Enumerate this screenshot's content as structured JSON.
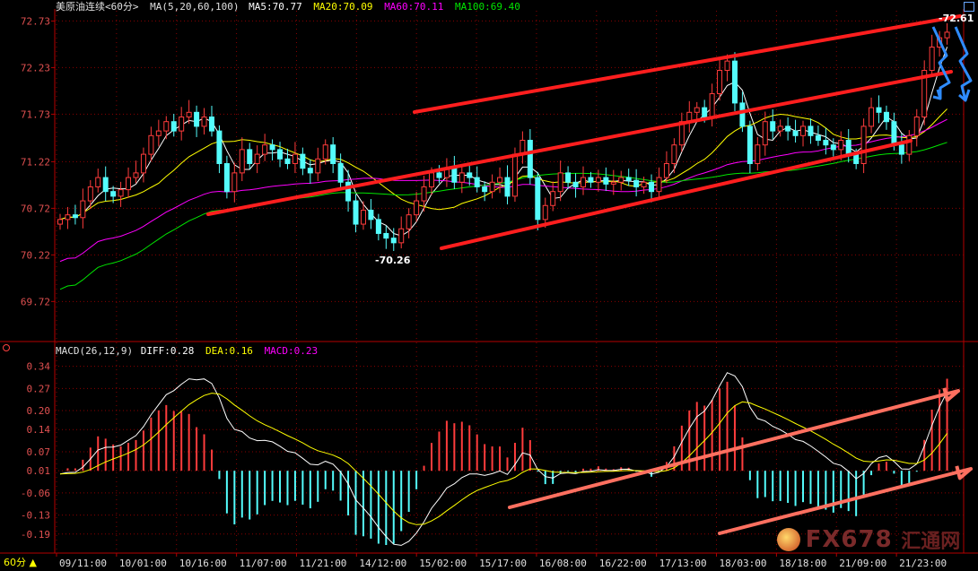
{
  "header": {
    "instrument": "美原油连续",
    "period": "<60分>",
    "ma_label": "MA(5,20,60,100)",
    "ma5": "MA5:70.77",
    "ma20": "MA20:70.09",
    "ma60": "MA60:70.11",
    "ma100": "MA100:69.40"
  },
  "macd_header": {
    "name": "MACD(26,12,9)",
    "diff": "DIFF:0.28",
    "dea": "DEA:0.16",
    "macd": "MACD:0.23"
  },
  "period_selector": "60分 ▲",
  "watermark": {
    "text": "FX678",
    "sub": "汇通网"
  },
  "colors": {
    "bg": "#000000",
    "up": "#ff3c3c",
    "down": "#54fcfc",
    "ma5": "#ffffff",
    "ma20": "#ffff00",
    "ma60": "#ff00ff",
    "ma100": "#00e600",
    "trend": "#ff1e1e",
    "arrow_up": "#ff7060",
    "blue_arrow": "#2f8cff",
    "grid": "#8a0000",
    "frame": "#b40000"
  },
  "chart_data": [
    {
      "type": "candlestick",
      "title": "美原油连续 <60分>",
      "y_ticks": [
        "72.73",
        "72.23",
        "71.73",
        "71.22",
        "70.72",
        "70.22",
        "69.72"
      ],
      "y_tick_values": [
        72.73,
        72.23,
        71.73,
        71.22,
        70.72,
        70.22,
        69.72
      ],
      "ylim": [
        69.3,
        72.84
      ],
      "x_ticks": [
        "09/11:00",
        "10/01:00",
        "10/16:00",
        "11/07:00",
        "11/21:00",
        "14/12:00",
        "15/02:00",
        "15/17:00",
        "16/08:00",
        "16/22:00",
        "17/13:00",
        "18/03:00",
        "18/18:00",
        "21/09:00",
        "21/23:00"
      ],
      "annotations": [
        {
          "label": "70.26",
          "value": 70.26
        },
        {
          "label": "72.61",
          "value": 72.61
        }
      ],
      "series": [
        {
          "name": "MA5",
          "value": 70.77
        },
        {
          "name": "MA20",
          "value": 70.09
        },
        {
          "name": "MA60",
          "value": 70.11
        },
        {
          "name": "MA100",
          "value": 69.4
        }
      ],
      "closes": [
        70.6,
        70.65,
        70.62,
        70.8,
        70.95,
        71.05,
        70.9,
        70.85,
        70.92,
        71.05,
        71.1,
        71.3,
        71.5,
        71.55,
        71.65,
        71.55,
        71.7,
        71.75,
        71.6,
        71.7,
        71.55,
        71.2,
        70.9,
        71.1,
        71.35,
        71.2,
        71.3,
        71.4,
        71.35,
        71.25,
        71.2,
        71.3,
        71.15,
        71.1,
        71.25,
        71.4,
        71.2,
        71.0,
        70.8,
        70.55,
        70.7,
        70.6,
        70.45,
        70.4,
        70.35,
        70.5,
        70.65,
        70.8,
        70.95,
        71.1,
        71.05,
        71.15,
        71.0,
        71.1,
        71.05,
        70.95,
        70.9,
        71.0,
        71.05,
        70.85,
        71.3,
        71.45,
        71.05,
        70.6,
        70.75,
        70.9,
        71.1,
        71.0,
        70.95,
        71.05,
        71.0,
        71.05,
        70.98,
        71.0,
        71.05,
        71.02,
        70.95,
        71.0,
        70.9,
        71.05,
        71.2,
        71.4,
        71.65,
        71.75,
        71.8,
        71.7,
        71.95,
        72.2,
        72.3,
        71.85,
        71.6,
        71.2,
        71.4,
        71.65,
        71.55,
        71.6,
        71.55,
        71.5,
        71.6,
        71.5,
        71.45,
        71.4,
        71.35,
        71.45,
        71.3,
        71.2,
        71.6,
        71.8,
        71.75,
        71.65,
        71.4,
        71.3,
        71.5,
        71.7,
        72.2,
        72.45,
        72.55,
        72.61
      ],
      "note_candles": "closes listed above; each candle's open is the previous close"
    },
    {
      "type": "bar",
      "title": "MACD(26,12,9)",
      "y_ticks": [
        "0.34",
        "0.27",
        "0.20",
        "0.14",
        "0.07",
        "0.01",
        "-0.06",
        "-0.13",
        "-0.19"
      ],
      "y_tick_values": [
        0.34,
        0.27,
        0.2,
        0.14,
        0.07,
        0.01,
        -0.06,
        -0.13,
        -0.19
      ],
      "ylim": [
        -0.25,
        0.37
      ],
      "series": [
        {
          "name": "DIFF",
          "value": 0.28
        },
        {
          "name": "DEA",
          "value": 0.16
        },
        {
          "name": "MACD",
          "value": 0.23
        }
      ]
    }
  ]
}
